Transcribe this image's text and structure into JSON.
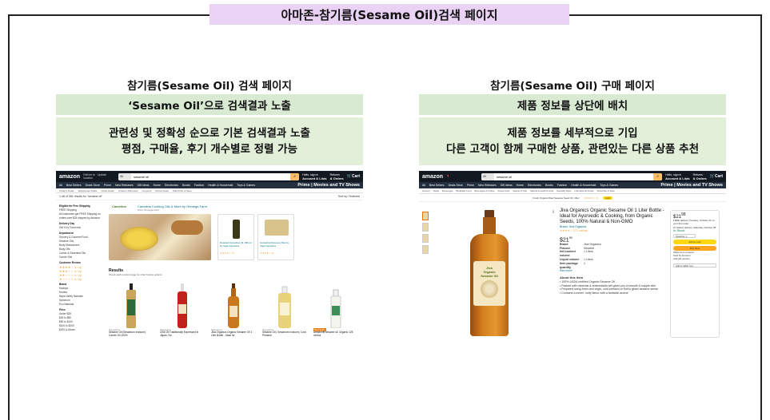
{
  "title": "아마존-참기름(Sesame Oil)검색 페이지",
  "left": {
    "heading": "참기름(Sesame Oil) 검색 페이지",
    "highlight": "‘Sesame Oil’으로 검색결과 노출",
    "desc_line1": "관련성 및 정확성 순으로 기본 검색결과 노출",
    "desc_line2": "평점, 구매율, 후기 개수별로 정렬 가능",
    "shot": {
      "logo": "amazon",
      "deliver": "Deliver to · Update location",
      "search_cat": "All",
      "search_text": "sesame oil",
      "account": "Hello, sign in",
      "account_b": "Account & Lists",
      "orders": "Returns",
      "orders_b": "& Orders",
      "cart": "Cart",
      "nav": [
        "All",
        "Best Sellers",
        "Deals Store",
        "Prime",
        "New Releases",
        "Gift Ideas",
        "Home",
        "Electronics",
        "Books",
        "Fashion",
        "Health & Household",
        "Toys & Games"
      ],
      "prime_banner": "Prime | Movies and TV Shows",
      "sub": [
        "Today's Deals",
        "Warehouse Deals",
        "Outlet Deals",
        "Amazon Renewed",
        "Coupons",
        "Movie Deals",
        "Subscribe & Save"
      ],
      "results_count": "1-48 of 561 results for \"sesame oil\"",
      "sort": "Sort by: Featured",
      "filters": {
        "h1": "Eligible for Free Shipping",
        "f1": "FREE Shipping",
        "f2": "All customers get FREE Shipping on orders over $25 shipped by Amazon",
        "h2": "Delivery Day",
        "f3": "Get It by Tomorrow",
        "h3": "Department",
        "f4": "Grocery & Gourmet Food",
        "f5": "Sesame Oils",
        "f6": "Body Moisturizers",
        "f7": "Body Oils",
        "f8": "Carrier & Essential Oils",
        "f9": "Carrier Oils",
        "h4": "Customer Review",
        "s1": "★★★★☆ & Up",
        "s2": "★★★☆☆ & Up",
        "s3": "★★☆☆☆ & Up",
        "s4": "★☆☆☆☆ & Up",
        "h5": "Brand",
        "b1": "Kadoya",
        "b2": "Kevala",
        "b3": "Napa Valley Naturals",
        "b4": "Spectrum",
        "b5": "Eco Naturals",
        "h6": "Price",
        "p1": "Under $25",
        "p2": "$25 to $50",
        "p3": "$50 to $100",
        "p4": "$100 to $200",
        "p5": "$200 & Above"
      },
      "sponsor": {
        "logo": "Camelina",
        "title": "Camelina Cooking Oils & More by Ohmega Farm",
        "sub": "Shop Ohmega Farm",
        "card1": "Roasted Camelina Oil, 250 ml by Ogat Camelina",
        "card2": "Camelina Discovery Box by Ogat Camelina",
        "card1_stars": "★★★★☆ 78",
        "card2_stars": "★★★★☆ 21"
      },
      "results_h": "Results",
      "results_s": "Check each product page for other buying options.",
      "products": [
        {
          "label": "Sponsored",
          "name": "Sesame Oil (Sesamum Indicum) Carrier Oil 100%"
        },
        {
          "label": "Sponsored",
          "name": "Chili Oil Traditionally Expressed in Japan, No"
        },
        {
          "label": "Sponsored",
          "name": "Jiva Organics Organic Sesame Oil 1 Liter Bottle - Ideal for"
        },
        {
          "label": "Sponsored",
          "name": "Sesame Oil | Sesamum Indicum | Cold Pressed"
        },
        {
          "label": "Best Seller",
          "name": "Amazonfit sesame oil, Organic 125 ml/4oz"
        }
      ]
    }
  },
  "right": {
    "heading": "참기름(Sesame Oil) 구매 페이지",
    "highlight": "제품 정보를 상단에 배치",
    "desc_line1": "제품 정보를 세부적으로 기입",
    "desc_line2": "다른 고객이 함께 구매한 상품, 관련있는 다른 상품 추천",
    "shot": {
      "logo": "amazon",
      "search_cat": "All",
      "search_text": "sesame oil",
      "account": "Hello, sign in",
      "account_b": "Account & Lists",
      "orders": "Returns",
      "orders_b": "& Orders",
      "cart": "Cart",
      "nav": [
        "All",
        "Best Sellers",
        "Deals Store",
        "Prime",
        "New Releases",
        "Gift Ideas",
        "Home",
        "Electronics",
        "Books",
        "Fashion",
        "Health & Household",
        "Toys & Games"
      ],
      "prime_banner": "Prime | Movies and TV Shows",
      "sub": [
        "Grocery",
        "Deals",
        "Beverages",
        "Breakfast Food",
        "Beverages & Coffee",
        "Snack Food",
        "Sauces & Oils",
        "Natural & Health Foods",
        "Specialty Diets",
        "International Foods",
        "Subscribe & Save"
      ],
      "ad_text": "Fresh Organic Raw Sesame Seed Oil, 16oz",
      "ad_stars": "★★★★☆ 74",
      "ad_add": "Add",
      "product_title": "Jiva Organics Organic Sesame Oil 1 Liter Bottle - Ideal for Ayurvedic & Cooking, from Organic Seeds, 100% Natural & Non-GMO",
      "brand": "Brand: Jiva Organics",
      "stars": "★★★★☆ 571 ratings",
      "price": "$21",
      "price_cents": "99",
      "specs": [
        {
          "k": "Brand",
          "v": "Jiva Organics"
        },
        {
          "k": "Flavour",
          "v": "Sesame"
        },
        {
          "k": "Net content volume",
          "v": "1 Liters"
        },
        {
          "k": "Liquid volume",
          "v": "1 Liters"
        },
        {
          "k": "Item package quantity",
          "v": "1"
        }
      ],
      "see_more": "See more",
      "about": "About this item",
      "bullets": [
        "• 100% USDA certified Organic Sesame Oil",
        "• Packed with minerals & antioxidants will gives you a smooth & supple skin",
        "• Prepared using fresh and virgin, cold pressed or Kohlu ghani sesame seeds",
        "• Contains a sweet, nutty flavor with a fantastic aroma"
      ],
      "label_line1": "Jiva",
      "label_line2": "Organic",
      "label_line3": "Sesame Oil",
      "buy": {
        "price": "$21",
        "price_cents": "99",
        "delivery": "FREE delivery Tuesday, October 31 on your first order",
        "fastest": "Or fastest delivery Saturday, October 28",
        "instock": "In Stock",
        "qty": "Quantity: 1",
        "add": "Add to Cart",
        "buynow": "Buy Now",
        "ships": "Ships from Amazon",
        "sold": "Sold by Amazon",
        "gift": "Add gift options",
        "list": "Add to Wish List"
      }
    }
  }
}
